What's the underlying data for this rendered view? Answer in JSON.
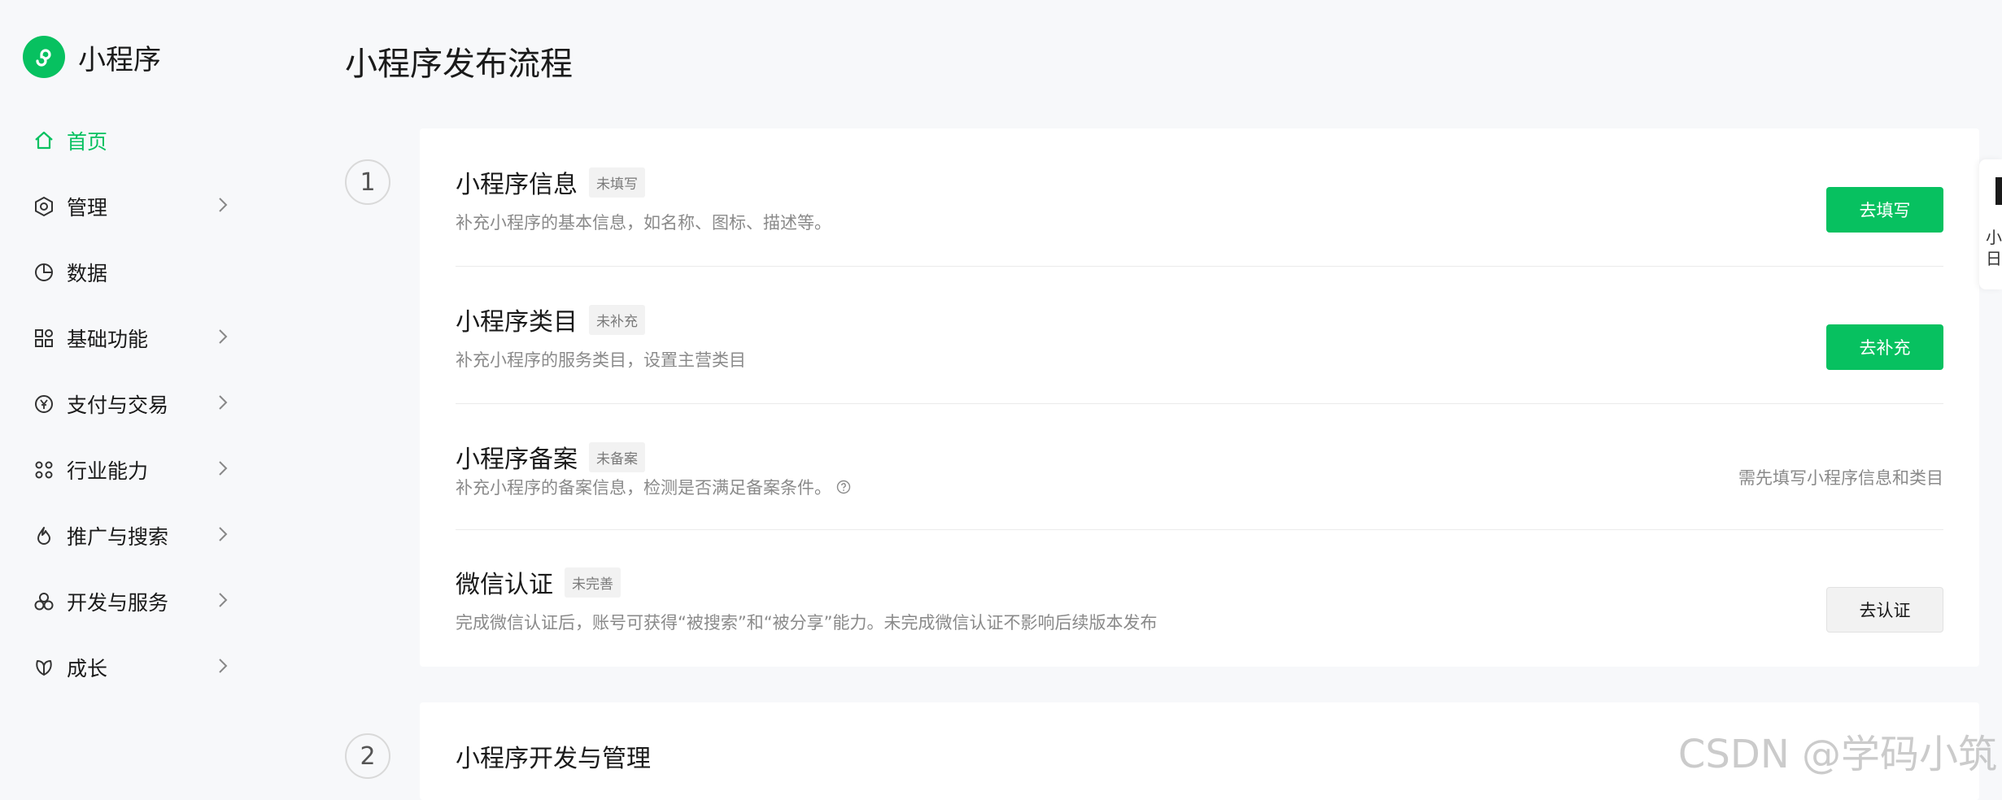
{
  "app": {
    "name": "小程序"
  },
  "colors": {
    "accent": "#07c160",
    "background": "#f7f8fa",
    "card": "#ffffff"
  },
  "sidebar": {
    "items": [
      {
        "label": "首页",
        "icon": "home-icon",
        "active": true
      },
      {
        "label": "管理",
        "icon": "hexagon-gear-icon"
      },
      {
        "label": "数据",
        "icon": "pie-chart-icon"
      },
      {
        "label": "基础功能",
        "icon": "grid-icon"
      },
      {
        "label": "支付与交易",
        "icon": "yuan-icon"
      },
      {
        "label": "行业能力",
        "icon": "nodes-icon"
      },
      {
        "label": "推广与搜索",
        "icon": "flame-icon"
      },
      {
        "label": "开发与服务",
        "icon": "cubes-icon"
      },
      {
        "label": "成长",
        "icon": "leaf-icon"
      }
    ]
  },
  "main": {
    "title": "小程序发布流程",
    "steps": [
      {
        "number": "1",
        "rows": [
          {
            "title": "小程序信息",
            "badge": "未填写",
            "desc": "补充小程序的基本信息，如名称、图标、描述等。",
            "action": "去填写"
          },
          {
            "title": "小程序类目",
            "badge": "未补充",
            "desc": "补充小程序的服务类目，设置主营类目",
            "action": "去补充"
          },
          {
            "title": "小程序备案",
            "badge": "未备案",
            "desc": "补充小程序的备案信息，检测是否满足备案条件。",
            "hint": "需先填写小程序信息和类目"
          },
          {
            "title": "微信认证",
            "badge": "未完善",
            "desc": "完成微信认证后，账号可获得“被搜索”和“被分享”能力。未完成微信认证不影响后续版本发布",
            "action": "去认证"
          }
        ]
      },
      {
        "number": "2",
        "title": "小程序开发与管理"
      }
    ]
  },
  "side_tab": {
    "line1": "小",
    "line2": "日"
  },
  "watermark": "CSDN @学码小筑"
}
